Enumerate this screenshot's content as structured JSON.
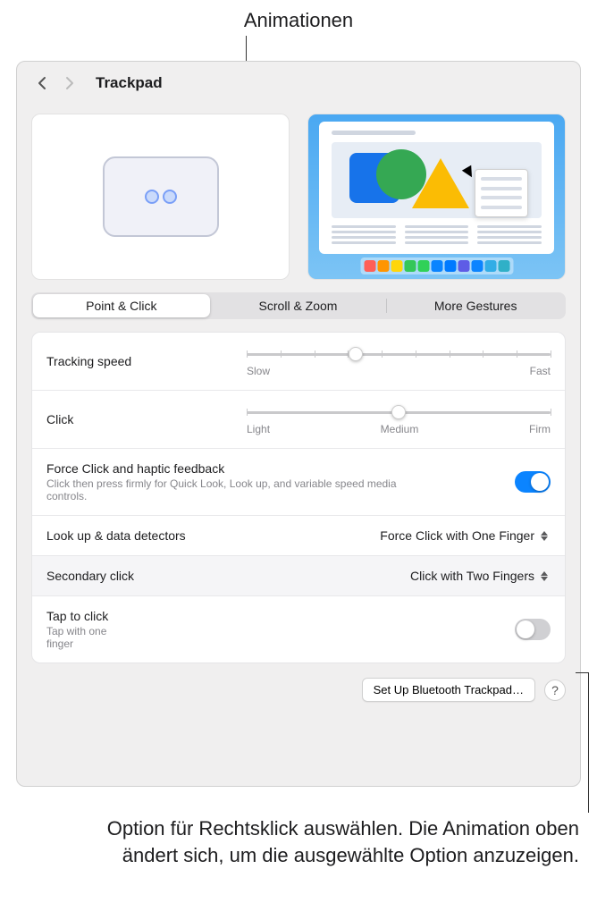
{
  "annotation_top": "Animationen",
  "annotation_bottom": "Option für Rechtsklick auswählen. Die Animation oben ändert sich, um die ausgewählte Option anzuzeigen.",
  "toolbar": {
    "title": "Trackpad"
  },
  "tabs": {
    "point_click": "Point & Click",
    "scroll_zoom": "Scroll & Zoom",
    "more_gestures": "More Gestures"
  },
  "settings": {
    "tracking_speed": {
      "label": "Tracking speed",
      "min": "Slow",
      "max": "Fast"
    },
    "click": {
      "label": "Click",
      "min": "Light",
      "mid": "Medium",
      "max": "Firm"
    },
    "force_click": {
      "label": "Force Click and haptic feedback",
      "sublabel": "Click then press firmly for Quick Look, Look up, and variable speed media controls."
    },
    "look_up": {
      "label": "Look up & data detectors",
      "value": "Force Click with One Finger"
    },
    "secondary_click": {
      "label": "Secondary click",
      "value": "Click with Two Fingers"
    },
    "tap_to_click": {
      "label": "Tap to click",
      "sublabel": "Tap with one finger"
    }
  },
  "footer": {
    "bluetooth": "Set Up Bluetooth Trackpad…",
    "help": "?"
  },
  "dock_colors": [
    "#ff5f57",
    "#ff9500",
    "#ffd60a",
    "#34c759",
    "#30d158",
    "#0a84ff",
    "#007aff",
    "#5e5ce6",
    "#0b84ff",
    "#32ade6",
    "#30b0c7"
  ]
}
